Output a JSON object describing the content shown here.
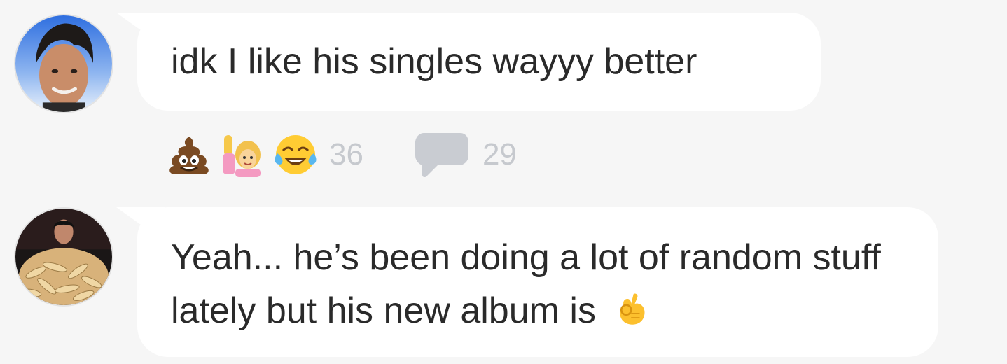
{
  "comments": [
    {
      "text": "idk I like his singles wayyy better",
      "reactions": [
        "pile-of-poo-emoji",
        "person-raising-hand-emoji",
        "tears-of-joy-emoji"
      ],
      "reaction_count": "36",
      "reply_count": "29"
    },
    {
      "text": "Yeah... he’s been doing a lot of random stuff lately but his new album is",
      "trailing_emoji": "ok-hand-emoji"
    }
  ],
  "colors": {
    "background": "#f6f6f6",
    "bubble": "#ffffff",
    "text": "#2a2a2a",
    "muted": "#c6c9ce"
  }
}
